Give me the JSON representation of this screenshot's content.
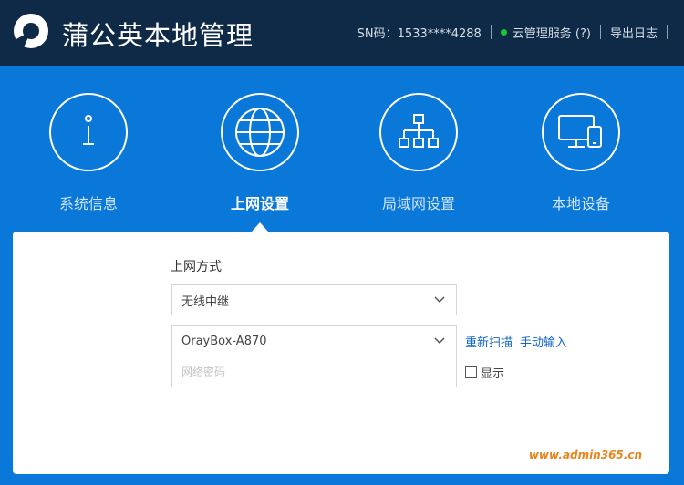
{
  "header": {
    "title": "蒲公英本地管理",
    "sn": "SN码：1533****4288",
    "cloud_service": "云管理服务 (?)",
    "logout": "导出日志",
    "status_color": "#19c63a",
    "icon": "pgy-logo-icon"
  },
  "nav": {
    "items": [
      {
        "label": "系统信息",
        "icon": "info-icon",
        "active": false
      },
      {
        "label": "上网设置",
        "icon": "globe-icon",
        "active": true
      },
      {
        "label": "局域网设置",
        "icon": "network-tree-icon",
        "active": false
      },
      {
        "label": "本地设备",
        "icon": "devices-icon",
        "active": false
      }
    ]
  },
  "form": {
    "section_title": "上网方式",
    "mode_value": "无线中继",
    "ssid_value": "OrayBox-A870",
    "password_placeholder": "网络密码",
    "rescan": "重新扫描",
    "manual_input": "手动输入",
    "show_label": "显示"
  },
  "watermark": "www.admin365.cn",
  "colors": {
    "header_bg": "#0e2a47",
    "page_bg": "#0a78d8",
    "link": "#1166c8"
  }
}
